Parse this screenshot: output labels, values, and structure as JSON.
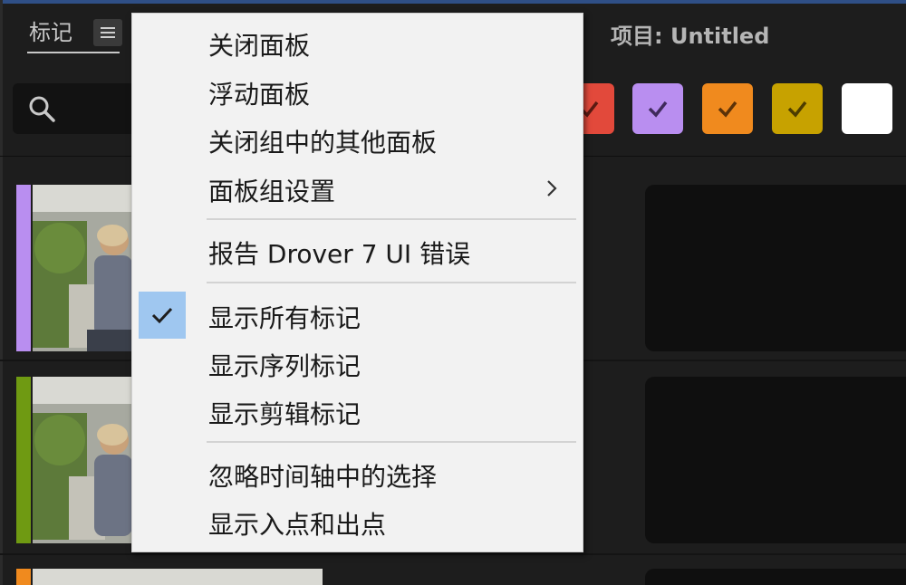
{
  "panel": {
    "tab_title": "标记",
    "project_label": "项目: Untitled"
  },
  "colors": {
    "swatches": [
      "#e2493b",
      "#b98ef0",
      "#f08a1e",
      "#c7a200",
      "#ffffff"
    ],
    "clip_labels": [
      "#b98ef0",
      "#6f9a12",
      "#f08a1e"
    ],
    "menu_check_highlight": "#9fc7f0"
  },
  "context_menu": {
    "items": [
      {
        "label": "关闭面板"
      },
      {
        "label": "浮动面板"
      },
      {
        "label": "关闭组中的其他面板"
      },
      {
        "label": "面板组设置",
        "submenu": true
      },
      {
        "label": "报告 Drover 7 UI 错误"
      },
      {
        "label": "显示所有标记",
        "checked": true
      },
      {
        "label": "显示序列标记"
      },
      {
        "label": "显示剪辑标记"
      },
      {
        "label": "忽略时间轴中的选择"
      },
      {
        "label": "显示入点和出点"
      }
    ]
  },
  "icons": [
    "hamburger-menu-icon",
    "search-icon",
    "checkmark-icon",
    "chevron-right-icon"
  ]
}
